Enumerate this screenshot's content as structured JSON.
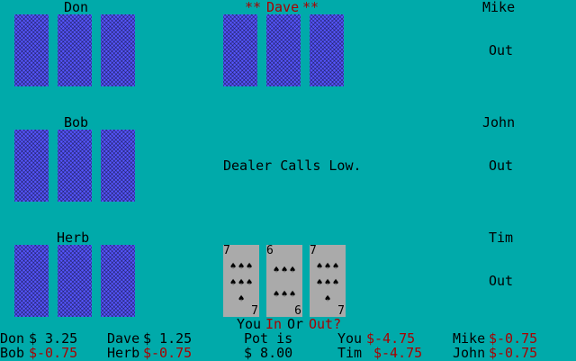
{
  "players": {
    "don": "Don",
    "dave": "Dave",
    "dave_dealer_marker": "**",
    "mike": "Mike",
    "bob": "Bob",
    "john": "John",
    "herb": "Herb",
    "tim": "Tim"
  },
  "status": {
    "mike": "Out",
    "john": "Out",
    "tim": "Out"
  },
  "message": "Dealer Calls Low.",
  "player_hand": [
    {
      "rank": "7",
      "suit": "spades"
    },
    {
      "rank": "6",
      "suit": "spades"
    },
    {
      "rank": "7",
      "suit": "spades"
    }
  ],
  "prompt": {
    "you": "You",
    "in": "In",
    "or": "Or",
    "out": "Out?"
  },
  "scoreboard": {
    "don_label": "Don",
    "don_value": "$ 3.25",
    "dave_label": "Dave",
    "dave_value": "$ 1.25",
    "pot_label": "Pot is",
    "pot_value": "$ 8.00",
    "you_label": "You",
    "you_value": "$-4.75",
    "mike_label": "Mike",
    "mike_value": "$-0.75",
    "bob_label": "Bob",
    "bob_value": "$-0.75",
    "herb_label": "Herb",
    "herb_value": "$-0.75",
    "tim_label": "Tim",
    "tim_value": "$-4.75",
    "john_label": "John",
    "john_value": "$-0.75"
  },
  "colors": {
    "table": "#00aaaa",
    "card_back": "#5555ff",
    "card_face": "#aaaaaa",
    "highlight": "#aa0000"
  }
}
